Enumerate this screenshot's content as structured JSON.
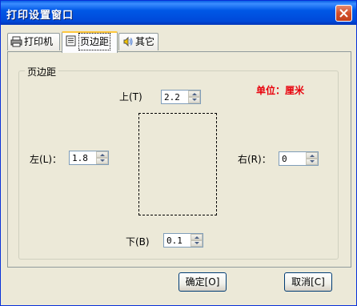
{
  "window": {
    "title": "打印设置窗口"
  },
  "tabs": [
    {
      "label": "打印机",
      "icon": "printer-icon"
    },
    {
      "label": "页边距",
      "icon": "page-icon"
    },
    {
      "label": "其它",
      "icon": "speaker-icon"
    }
  ],
  "active_tab": "页边距",
  "group": {
    "label": "页边距"
  },
  "unit_label": "单位：厘米",
  "margins": {
    "top": {
      "label": "上(T)",
      "value": "2.2"
    },
    "left": {
      "label": "左(L)：",
      "value": "1.8"
    },
    "right": {
      "label": "右(R)：",
      "value": "0"
    },
    "bottom": {
      "label": "下(B)",
      "value": "0.1"
    }
  },
  "buttons": {
    "ok": "确定[O]",
    "cancel": "取消[C]"
  },
  "colors": {
    "titlebar": "#0058e6",
    "unit_text": "#e8000b",
    "dialog_bg": "#ece9d8"
  }
}
